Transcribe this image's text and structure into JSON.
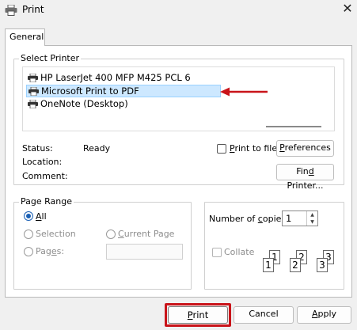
{
  "window": {
    "title": "Print",
    "close_label": "✕"
  },
  "tabs": [
    {
      "label": "General"
    }
  ],
  "select_printer": {
    "label": "Select Printer",
    "printers": [
      {
        "name": "HP LaserJet 400 MFP M425 PCL 6",
        "selected": false
      },
      {
        "name": "Microsoft Print to PDF",
        "selected": true
      },
      {
        "name": "OneNote (Desktop)",
        "selected": false
      }
    ],
    "status_label": "Status:",
    "status_value": "Ready",
    "location_label": "Location:",
    "comment_label": "Comment:",
    "print_to_file_pre": "",
    "print_to_file_u": "P",
    "print_to_file_post": "rint to file",
    "preferences_u": "P",
    "preferences_post": "references",
    "find_printer_pre": "Fin",
    "find_printer_u": "d",
    "find_printer_post": " Printer...",
    "annotation_color": "#c9141a"
  },
  "page_range": {
    "label": "Page Range",
    "all_u": "A",
    "all_post": "ll",
    "selection_label": "Selection",
    "current_page_u": "C",
    "current_page_post": "urrent Page",
    "pages_pre": "Pag",
    "pages_u": "e",
    "pages_post": "s:"
  },
  "copies": {
    "label_pre": "Number of ",
    "label_u": "c",
    "label_post": "opies:",
    "value": "1",
    "collate_label": "Collate",
    "collate_icon_pages": [
      "1",
      "1",
      "2",
      "2",
      "3",
      "3"
    ]
  },
  "buttons": {
    "print_u": "P",
    "print_post": "rint",
    "cancel_label": "Cancel",
    "apply_u": "A",
    "apply_post": "pply"
  }
}
